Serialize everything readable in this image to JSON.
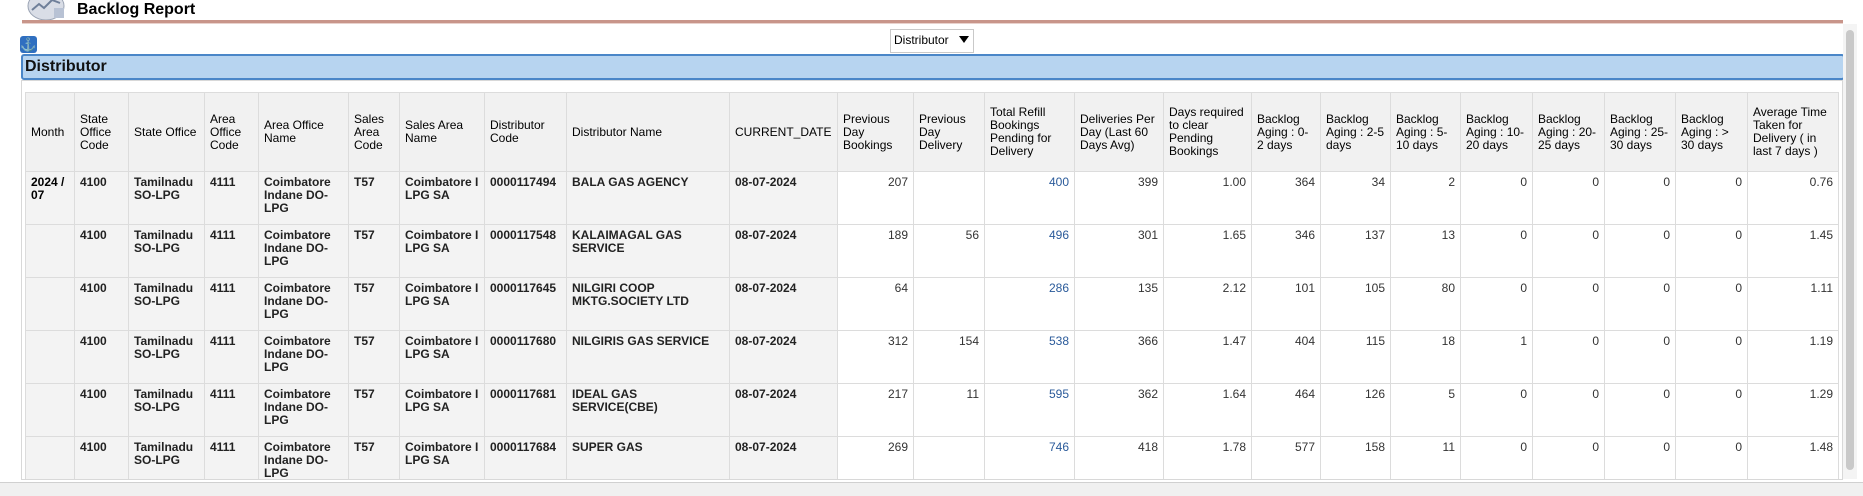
{
  "header": {
    "title": "Backlog Report",
    "logo_icon": "report-chart-icon"
  },
  "filter": {
    "selected": "Distributor"
  },
  "section": {
    "title": "Distributor"
  },
  "table": {
    "columns": [
      "Month",
      "State Office Code",
      "State Office",
      "Area Office Code",
      "Area Office Name",
      "Sales Area Code",
      "Sales Area Name",
      "Distributor Code",
      "Distributor Name",
      "CURRENT_DATE",
      "Previous Day Bookings",
      "Previous Day Delivery",
      "Total Refill Bookings Pending for Delivery",
      "Deliveries Per Day (Last 60 Days Avg)",
      "Days required to clear Pending Bookings",
      "Backlog Aging : 0-2 days",
      "Backlog Aging : 2-5 days",
      "Backlog Aging : 5-10 days",
      "Backlog Aging : 10-20 days",
      "Backlog Aging : 20-25 days",
      "Backlog Aging : 25-30 days",
      "Backlog Aging : > 30 days",
      "Average Time Taken for Delivery ( in last 7 days )"
    ],
    "month": "2024 / 07",
    "rows": [
      [
        "4100",
        "Tamilnadu SO-LPG",
        "4111",
        "Coimbatore Indane DO-LPG",
        "T57",
        "Coimbatore I LPG SA",
        "0000117494",
        "BALA GAS AGENCY",
        "08-07-2024",
        "207",
        "",
        "400",
        "399",
        "1.00",
        "364",
        "34",
        "2",
        "0",
        "0",
        "0",
        "0",
        "0.76"
      ],
      [
        "4100",
        "Tamilnadu SO-LPG",
        "4111",
        "Coimbatore Indane DO-LPG",
        "T57",
        "Coimbatore I LPG SA",
        "0000117548",
        "KALAIMAGAL GAS SERVICE",
        "08-07-2024",
        "189",
        "56",
        "496",
        "301",
        "1.65",
        "346",
        "137",
        "13",
        "0",
        "0",
        "0",
        "0",
        "1.45"
      ],
      [
        "4100",
        "Tamilnadu SO-LPG",
        "4111",
        "Coimbatore Indane DO-LPG",
        "T57",
        "Coimbatore I LPG SA",
        "0000117645",
        "NILGIRI COOP MKTG.SOCIETY LTD",
        "08-07-2024",
        "64",
        "",
        "286",
        "135",
        "2.12",
        "101",
        "105",
        "80",
        "0",
        "0",
        "0",
        "0",
        "1.11"
      ],
      [
        "4100",
        "Tamilnadu SO-LPG",
        "4111",
        "Coimbatore Indane DO-LPG",
        "T57",
        "Coimbatore I LPG SA",
        "0000117680",
        "NILGIRIS GAS SERVICE",
        "08-07-2024",
        "312",
        "154",
        "538",
        "366",
        "1.47",
        "404",
        "115",
        "18",
        "1",
        "0",
        "0",
        "0",
        "1.19"
      ],
      [
        "4100",
        "Tamilnadu SO-LPG",
        "4111",
        "Coimbatore Indane DO-LPG",
        "T57",
        "Coimbatore I LPG SA",
        "0000117681",
        "IDEAL GAS SERVICE(CBE)",
        "08-07-2024",
        "217",
        "11",
        "595",
        "362",
        "1.64",
        "464",
        "126",
        "5",
        "0",
        "0",
        "0",
        "0",
        "1.29"
      ],
      [
        "4100",
        "Tamilnadu SO-LPG",
        "4111",
        "Coimbatore Indane DO-LPG",
        "T57",
        "Coimbatore I LPG SA",
        "0000117684",
        "SUPER GAS",
        "08-07-2024",
        "269",
        "",
        "746",
        "418",
        "1.78",
        "577",
        "158",
        "11",
        "0",
        "0",
        "0",
        "0",
        "1.48"
      ]
    ]
  }
}
